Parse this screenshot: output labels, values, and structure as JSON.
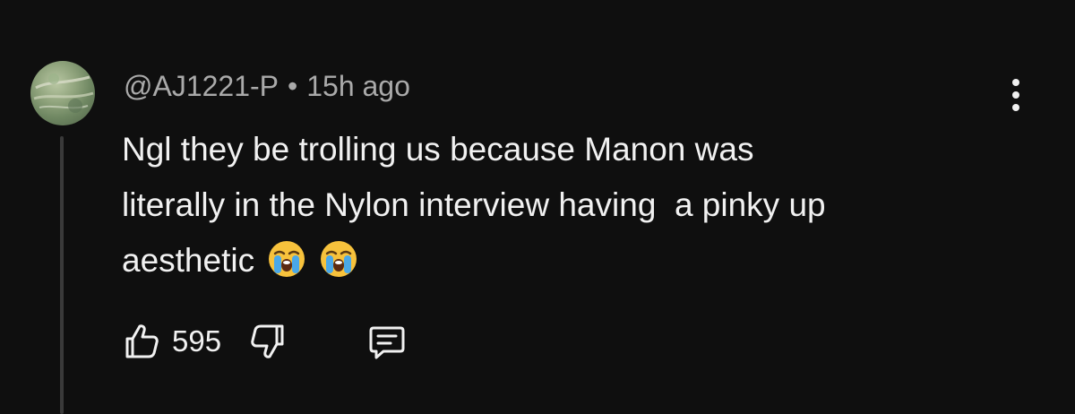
{
  "comment": {
    "author": "@AJ1221-P",
    "separator": "•",
    "timestamp": "15h ago",
    "text_lines": [
      "Ngl they be trolling us because Manon was",
      "literally in the Nylon interview having  a pinky up",
      "aesthetic"
    ],
    "emojis": [
      "loudly-crying-face",
      "loudly-crying-face"
    ],
    "like_count": "595"
  },
  "icons": {
    "like": "thumbs-up-icon",
    "dislike": "thumbs-down-icon",
    "reply": "reply-comment-icon",
    "menu": "more-vertical-icon"
  },
  "colors": {
    "background": "#0f0f0f",
    "text": "#f1f1f1",
    "meta": "#aaaaaa",
    "thread_line": "#3a3a3a"
  }
}
